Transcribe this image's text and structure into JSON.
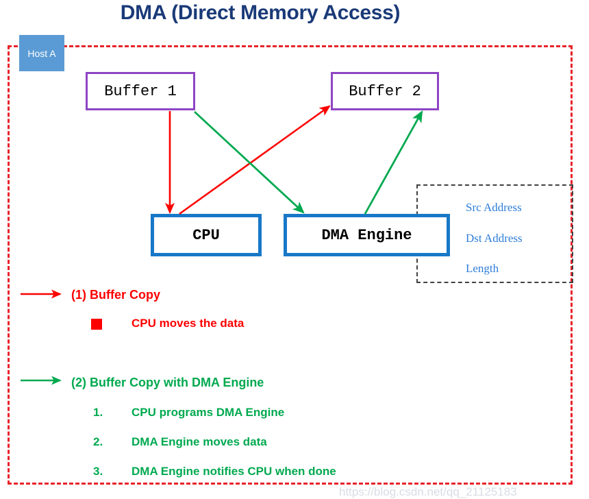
{
  "title": "DMA (Direct Memory Access)",
  "host": {
    "label": "Host A",
    "label_bg": "#5b9bd5",
    "border_color": "#e8232a"
  },
  "nodes": {
    "buffer1": {
      "label": "Buffer 1",
      "border_color": "#8e44c4"
    },
    "buffer2": {
      "label": "Buffer 2",
      "border_color": "#8e44c4"
    },
    "cpu": {
      "label": "CPU",
      "border_color": "#1878c8"
    },
    "dma_engine": {
      "label": "DMA Engine",
      "border_color": "#1878c8"
    }
  },
  "descriptor": {
    "border_color": "#404040",
    "text_color": "#2e7ed8",
    "fields": [
      {
        "label": "Src Address"
      },
      {
        "label": "Dst Address"
      },
      {
        "label": "Length"
      }
    ]
  },
  "arrows": [
    {
      "name": "buffer1-to-cpu",
      "color": "#fd0000",
      "flow": "(1) Buffer Copy"
    },
    {
      "name": "cpu-to-buffer2",
      "color": "#fd0000",
      "flow": "(1) Buffer Copy"
    },
    {
      "name": "buffer1-to-dma-engine",
      "color": "#00a94f",
      "flow": "(2) Buffer Copy with DMA Engine"
    },
    {
      "name": "dma-engine-to-buffer2",
      "color": "#00a94f",
      "flow": "(2) Buffer Copy with DMA Engine"
    }
  ],
  "legend": {
    "flow1": {
      "color": "#fd0000",
      "label": "(1) Buffer Copy",
      "items": [
        {
          "marker": "■",
          "text": "CPU moves the data"
        }
      ]
    },
    "flow2": {
      "color": "#00a94f",
      "label": "(2) Buffer Copy with DMA Engine",
      "items": [
        {
          "marker": "1.",
          "text": "CPU programs DMA Engine"
        },
        {
          "marker": "2.",
          "text": "DMA Engine moves data"
        },
        {
          "marker": "3.",
          "text": "DMA Engine notifies CPU when done"
        }
      ]
    }
  },
  "watermark": "https://blog.csdn.net/qq_21125183"
}
